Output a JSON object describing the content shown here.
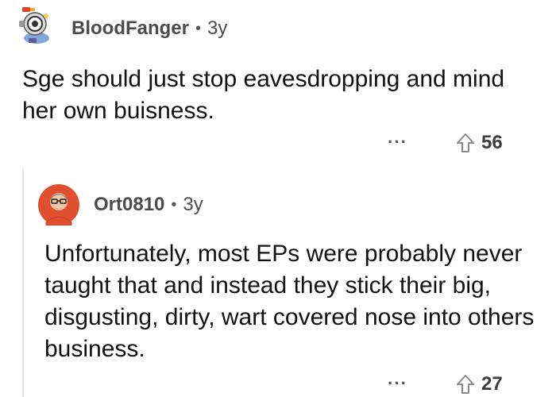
{
  "top_comment": {
    "author": "BloodFanger",
    "separator": "•",
    "age": "3y",
    "body": "Sge should just stop eavesdropping and mind her own buisness.",
    "more": "···",
    "upvotes": "56",
    "avatar_icon": "snoo-avatar-icon"
  },
  "reply": {
    "author": "Ort0810",
    "separator": "•",
    "age": "3y",
    "body": "Unfortunately, most EPs were probably never taught that and instead they stick their big, disgusting, dirty, wart covered nose into others business.",
    "more": "···",
    "upvotes": "27",
    "avatar_icon": "person-avatar-icon"
  },
  "colors": {
    "text": "#111111",
    "meta": "#4c4c4c",
    "thread_line": "#e4e4e4",
    "reply_avatar_bg": "#e0502e"
  }
}
